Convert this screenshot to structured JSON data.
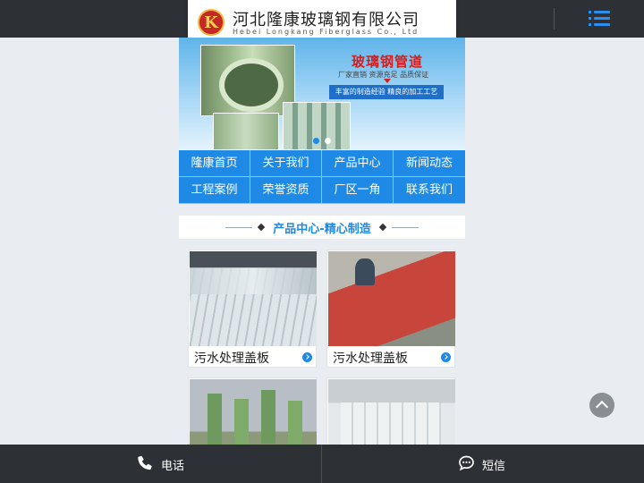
{
  "header": {
    "logo_letter": "K",
    "company_cn": "河北隆康玻璃钢有限公司",
    "company_en": "Hebei Longkang Fiberglass Co., Ltd",
    "menu_icon": "hamburger-menu-icon"
  },
  "banner": {
    "title": "玻璃钢管道",
    "subtitle": "厂家直销  资源充足  品质保证",
    "strip": "丰富的制造经验  精良的加工工艺",
    "active_slide": 1,
    "slide_count": 2
  },
  "nav": {
    "items": [
      {
        "label": "隆康首页"
      },
      {
        "label": "关于我们"
      },
      {
        "label": "产品中心"
      },
      {
        "label": "新闻动态"
      },
      {
        "label": "工程案例"
      },
      {
        "label": "荣誉资质"
      },
      {
        "label": "厂区一角"
      },
      {
        "label": "联系我们"
      }
    ]
  },
  "section": {
    "title": "产品中心-精心制造"
  },
  "products": [
    {
      "label": "污水处理盖板"
    },
    {
      "label": "污水处理盖板"
    },
    {
      "label": ""
    },
    {
      "label": ""
    }
  ],
  "footer": {
    "phone_label": "电话",
    "sms_label": "短信"
  },
  "colors": {
    "accent": "#1f8ae6",
    "bar": "#2d3035",
    "page_bg": "#e9edf2"
  }
}
